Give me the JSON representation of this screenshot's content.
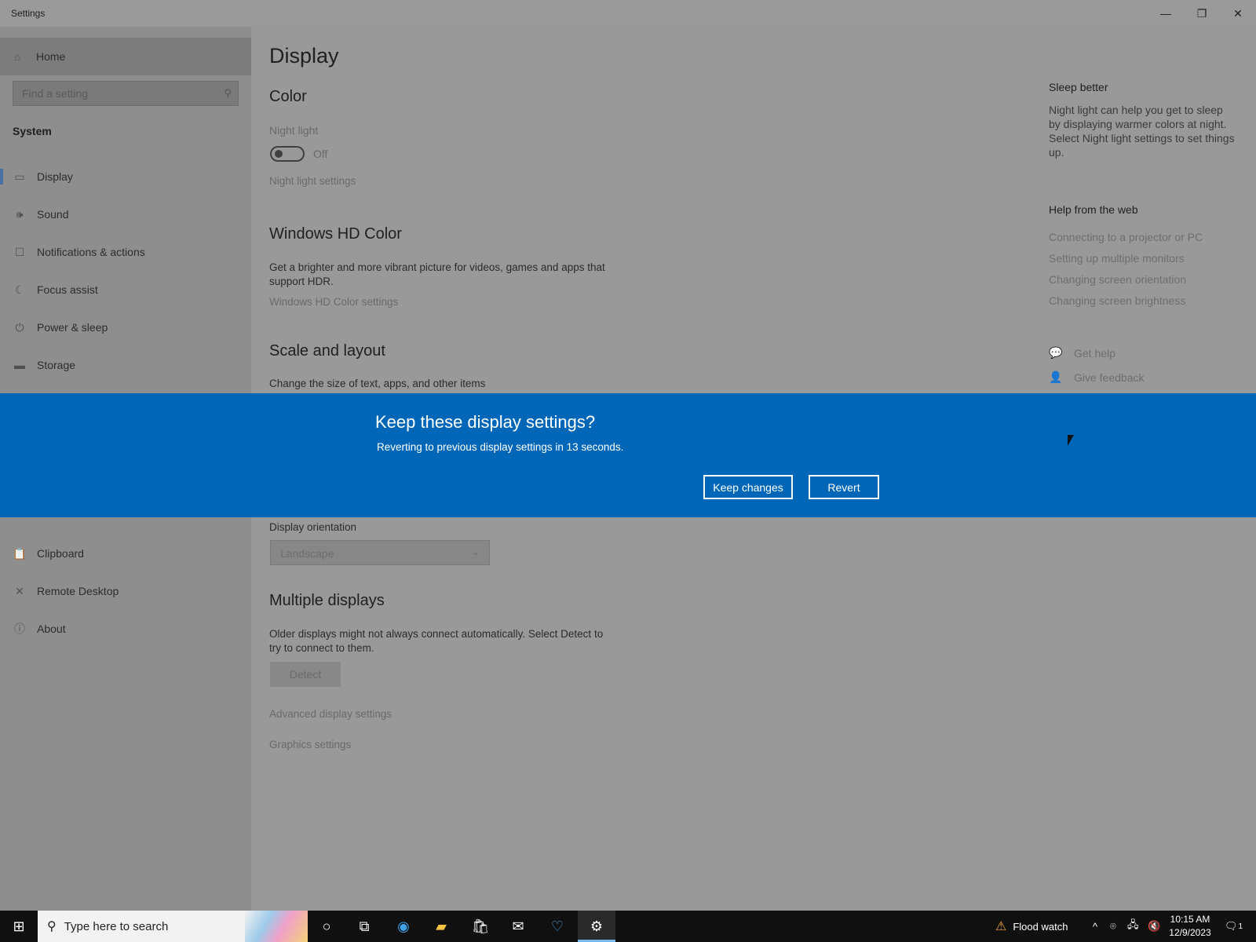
{
  "window": {
    "title": "Settings",
    "minimize": "—",
    "maximize": "❐",
    "close": "✕"
  },
  "sidebar": {
    "home": "Home",
    "search_placeholder": "Find a setting",
    "section": "System",
    "items": [
      {
        "label": "Display",
        "icon": "monitor-icon"
      },
      {
        "label": "Sound",
        "icon": "speaker-icon"
      },
      {
        "label": "Notifications & actions",
        "icon": "notification-icon"
      },
      {
        "label": "Focus assist",
        "icon": "moon-icon"
      },
      {
        "label": "Power & sleep",
        "icon": "power-icon"
      },
      {
        "label": "Storage",
        "icon": "storage-icon"
      },
      {
        "label": "Clipboard",
        "icon": "clipboard-icon"
      },
      {
        "label": "Remote Desktop",
        "icon": "remote-icon"
      },
      {
        "label": "About",
        "icon": "info-icon"
      }
    ]
  },
  "main": {
    "page_title": "Display",
    "color": {
      "heading": "Color",
      "night_light_label": "Night light",
      "toggle_state": "Off",
      "night_light_settings": "Night light settings"
    },
    "hd_color": {
      "heading": "Windows HD Color",
      "description_line1": "Get a brighter and more vibrant picture for videos, games and apps that",
      "description_line2": "support HDR.",
      "settings_link": "Windows HD Color settings"
    },
    "scale": {
      "heading": "Scale and layout",
      "description": "Change the size of text, apps, and other items"
    },
    "orientation": {
      "label": "Display orientation",
      "value": "Landscape"
    },
    "multiple": {
      "heading": "Multiple displays",
      "description_line1": "Older displays might not always connect automatically. Select Detect to",
      "description_line2": "try to connect to them.",
      "detect_button": "Detect"
    },
    "advanced_link": "Advanced display settings",
    "graphics_link": "Graphics settings"
  },
  "right_panel": {
    "sleep_heading": "Sleep better",
    "sleep_lines": [
      "Night light can help you get to sleep",
      "by displaying warmer colors at night.",
      "Select Night light settings to set things",
      "up."
    ],
    "help_heading": "Help from the web",
    "help_links": [
      "Connecting to a projector or PC",
      "Setting up multiple monitors",
      "Changing screen orientation",
      "Changing screen brightness"
    ],
    "get_help": "Get help",
    "give_feedback": "Give feedback"
  },
  "dialog": {
    "title": "Keep these display settings?",
    "message": "Reverting to previous display settings in 13 seconds.",
    "keep_button": "Keep changes",
    "revert_button": "Revert"
  },
  "taskbar": {
    "search_text": "Type here to search",
    "weather": "Flood watch",
    "time": "10:15 AM",
    "date": "12/9/2023",
    "notification_count": "1"
  },
  "colors": {
    "dialog_accent": "#0067b8",
    "taskbar": "#101010"
  }
}
